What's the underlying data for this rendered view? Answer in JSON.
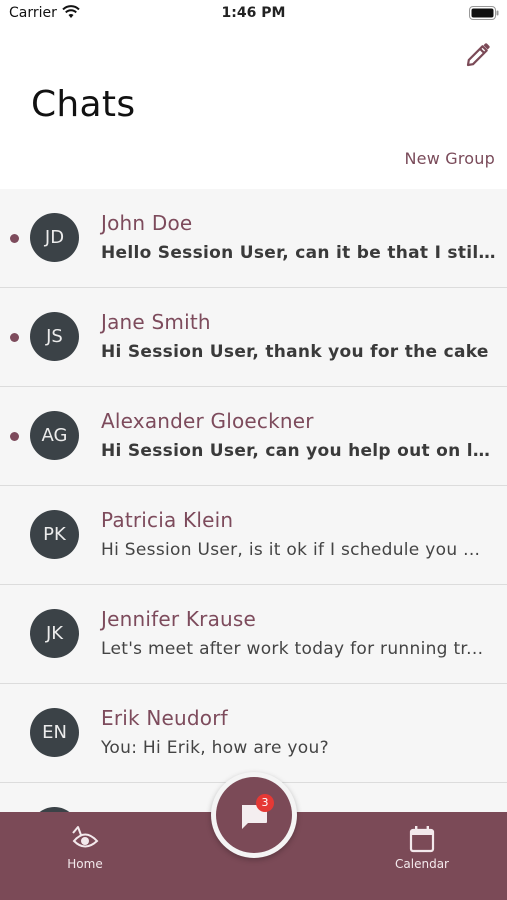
{
  "status_bar": {
    "carrier": "Carrier",
    "time": "1:46 PM"
  },
  "header": {
    "title": "Chats",
    "new_group_label": "New Group"
  },
  "chats": [
    {
      "initials": "JD",
      "name": "John Doe",
      "message": "Hello Session User, can it be that I still...",
      "unread": true
    },
    {
      "initials": "JS",
      "name": "Jane Smith",
      "message": "Hi Session User, thank you for the cake",
      "unread": true
    },
    {
      "initials": "AG",
      "name": "Alexander Gloeckner",
      "message": "Hi Session User, can you help out on li...",
      "unread": true
    },
    {
      "initials": "PK",
      "name": "Patricia Klein",
      "message": "Hi Session User, is it ok if I schedule you ...",
      "unread": false
    },
    {
      "initials": "JK",
      "name": "Jennifer Krause",
      "message": "Let's meet after work today for running tr...",
      "unread": false
    },
    {
      "initials": "EN",
      "name": "Erik Neudorf",
      "message": "You: Hi Erik, how are you?",
      "unread": false
    }
  ],
  "fab": {
    "badge_count": "3"
  },
  "nav": {
    "home_label": "Home",
    "calendar_label": "Calendar"
  },
  "colors": {
    "accent": "#7b4a57",
    "avatar": "#3b4247",
    "badge": "#e53935"
  }
}
